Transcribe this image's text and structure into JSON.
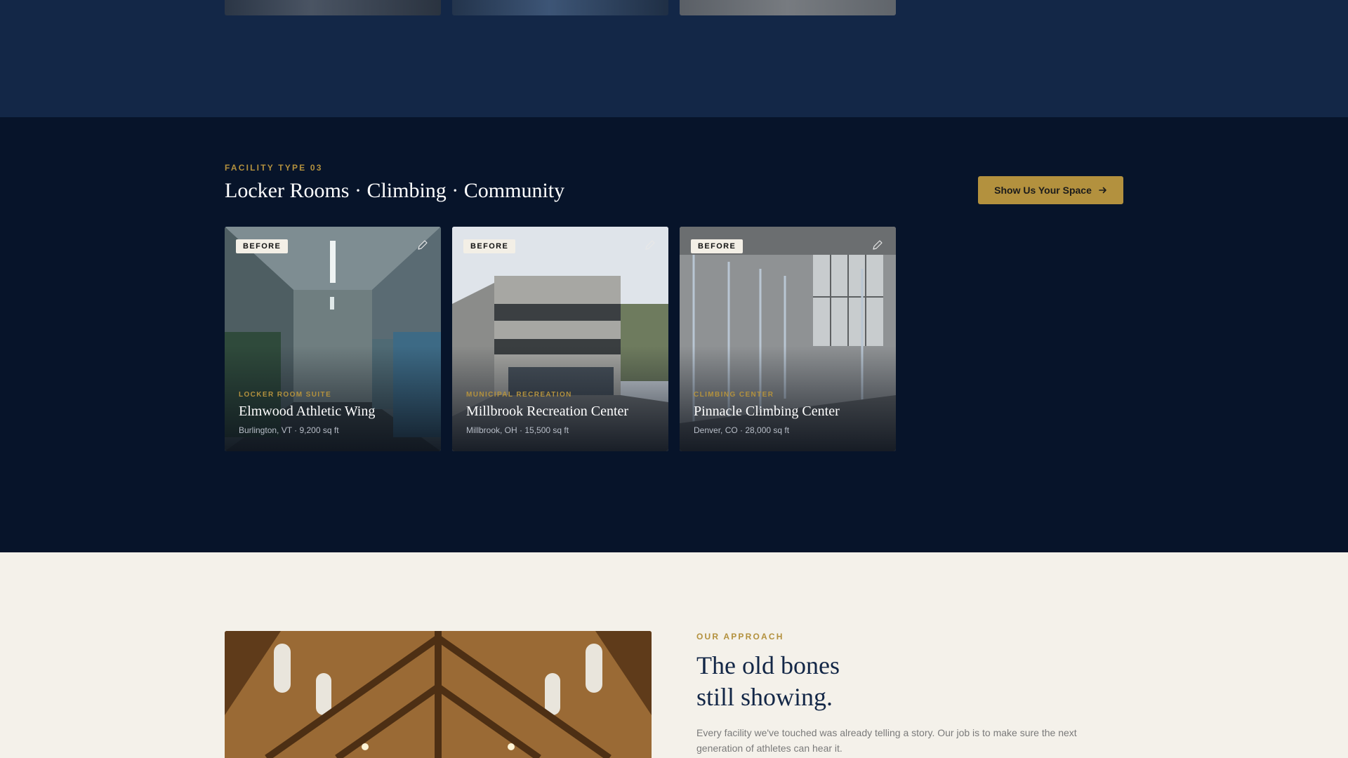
{
  "section": {
    "eyebrow": "FACILITY TYPE 03",
    "title": "Locker Rooms · Climbing · Community",
    "cta_label": "Show Us Your Space"
  },
  "cards": [
    {
      "badge": "BEFORE",
      "category": "LOCKER ROOM SUITE",
      "name": "Elmwood Athletic Wing",
      "meta": "Burlington, VT · 9,200 sq ft"
    },
    {
      "badge": "BEFORE",
      "category": "MUNICIPAL RECREATION",
      "name": "Millbrook Recreation Center",
      "meta": "Millbrook, OH · 15,500 sq ft"
    },
    {
      "badge": "BEFORE",
      "category": "CLIMBING CENTER",
      "name": "Pinnacle Climbing Center",
      "meta": "Denver, CO · 28,000 sq ft"
    }
  ],
  "approach": {
    "eyebrow": "OUR APPROACH",
    "title_line1": "The old bones",
    "title_line2": "still showing.",
    "lead": "Every facility we've touched was already telling a story. Our job is to make sure the next generation of athletes can hear it."
  },
  "colors": {
    "navy": "#132747",
    "dark_navy": "#07142a",
    "gold": "#b3913e",
    "cream": "#f4f1ea"
  },
  "icons": {
    "card_action": "pencil-icon",
    "cta": "arrow-right-icon"
  }
}
